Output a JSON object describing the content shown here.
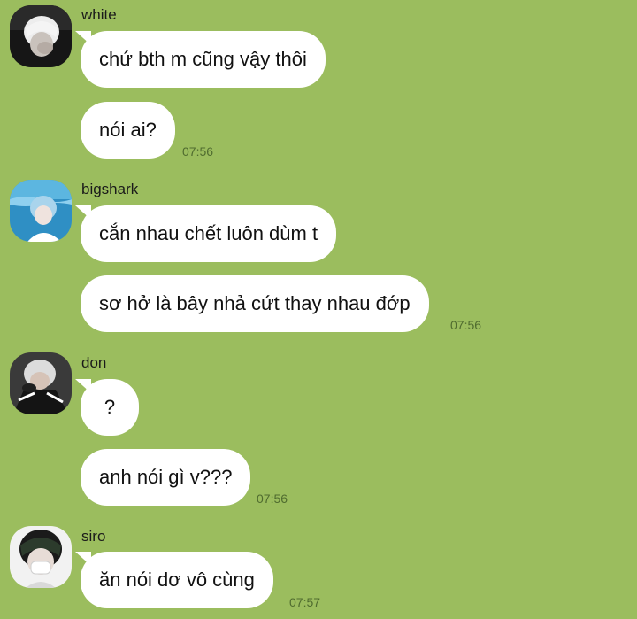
{
  "chat": {
    "groups": [
      {
        "sender": "white",
        "avatar_icon": "user-avatar-white",
        "messages": [
          "chứ bth m cũng vậy thôi",
          "nói ai?"
        ],
        "time": "07:56"
      },
      {
        "sender": "bigshark",
        "avatar_icon": "user-avatar-bigshark",
        "messages": [
          "cắn nhau chết luôn dùm t",
          "sơ hở là bây nhả cứt thay nhau đớp"
        ],
        "time": "07:56"
      },
      {
        "sender": "don",
        "avatar_icon": "user-avatar-don",
        "messages": [
          "?",
          "anh nói gì v???"
        ],
        "time": "07:56"
      },
      {
        "sender": "siro",
        "avatar_icon": "user-avatar-siro",
        "messages": [
          "ăn nói dơ vô cùng"
        ],
        "time": "07:57"
      }
    ]
  },
  "colors": {
    "background": "#9bbd5e",
    "bubble": "#ffffff",
    "timestamp": "#4f6b2f"
  }
}
